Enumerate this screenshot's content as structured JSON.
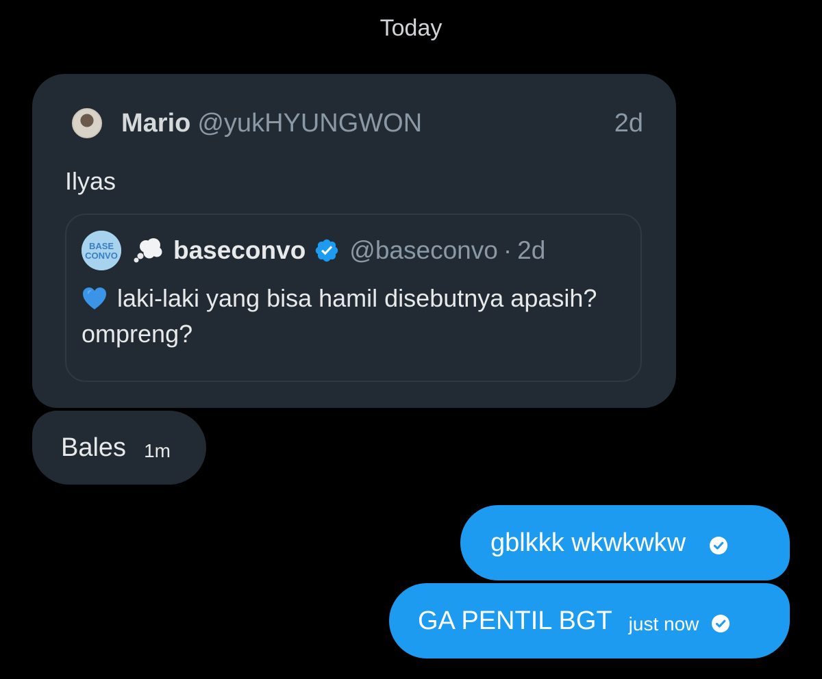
{
  "conversation": {
    "date_divider": "Today"
  },
  "shared_tweet": {
    "author_name": "Mario",
    "author_handle": "@yukHYUNGWON",
    "time": "2d",
    "text": "Ilyas",
    "quoted": {
      "avatar_text": "BASE CONVO",
      "name": "baseconvo",
      "handle": "@baseconvo",
      "separator": "·",
      "time": "2d",
      "text": "laki-laki yang bisa hamil disebutnya apasih? ompreng?"
    }
  },
  "messages": [
    {
      "direction": "received",
      "text": "Bales",
      "time": "1m"
    },
    {
      "direction": "sent",
      "text": "gblkkk wkwkwkw",
      "time": ""
    },
    {
      "direction": "sent",
      "text": "GA PENTIL BGT",
      "time": "just now"
    }
  ],
  "colors": {
    "background": "#000000",
    "received_bubble": "#222b33",
    "sent_bubble": "#1d9bf0",
    "verified": "#1d9bf0",
    "muted_text": "#8b98a5"
  },
  "icons": {
    "verified": "verified-badge-icon",
    "read_receipt": "check-circle-icon",
    "quote_emoji": "thought-balloon-icon",
    "heart_emoji": "blue-heart-icon"
  }
}
